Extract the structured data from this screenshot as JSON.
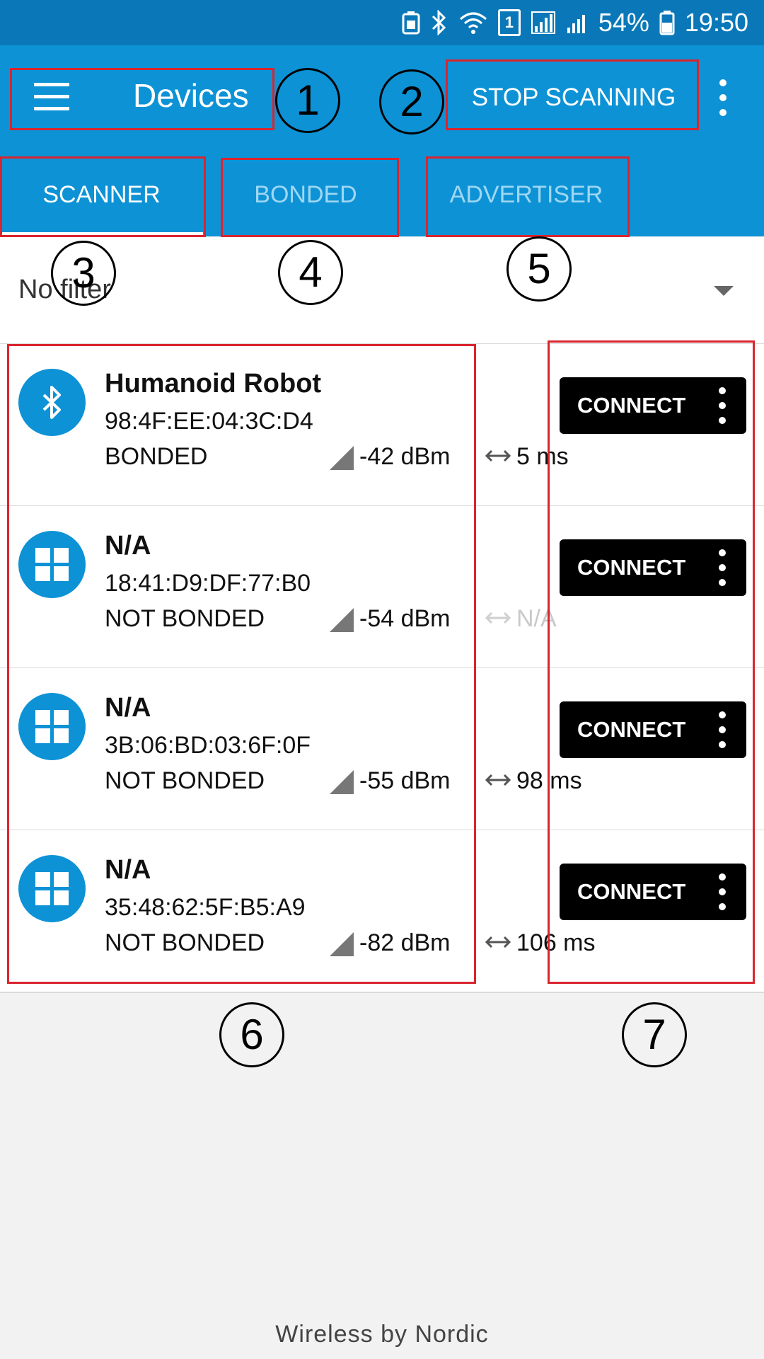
{
  "status_bar": {
    "battery_percent": "54%",
    "time": "19:50",
    "sim_slot": "1"
  },
  "app_bar": {
    "title": "Devices",
    "action_label": "STOP SCANNING"
  },
  "tabs": [
    {
      "label": "SCANNER",
      "active": true
    },
    {
      "label": "BONDED",
      "active": false
    },
    {
      "label": "ADVERTISER",
      "active": false
    }
  ],
  "filter": {
    "selected": "No filter"
  },
  "devices": [
    {
      "icon": "bluetooth-icon",
      "name": "Humanoid Robot",
      "address": "98:4F:EE:04:3C:D4",
      "bond_state": "BONDED",
      "rssi": "-42 dBm",
      "interval": "5 ms",
      "connect_label": "CONNECT"
    },
    {
      "icon": "windows-icon",
      "name": "N/A",
      "address": "18:41:D9:DF:77:B0",
      "bond_state": "NOT BONDED",
      "rssi": "-54 dBm",
      "interval": "N/A",
      "connect_label": "CONNECT"
    },
    {
      "icon": "windows-icon",
      "name": "N/A",
      "address": "3B:06:BD:03:6F:0F",
      "bond_state": "NOT BONDED",
      "rssi": "-55 dBm",
      "interval": "98 ms",
      "connect_label": "CONNECT"
    },
    {
      "icon": "windows-icon",
      "name": "N/A",
      "address": "35:48:62:5F:B5:A9",
      "bond_state": "NOT BONDED",
      "rssi": "-82 dBm",
      "interval": "106 ms",
      "connect_label": "CONNECT"
    }
  ],
  "annotations": [
    "1",
    "2",
    "3",
    "4",
    "5",
    "6",
    "7"
  ],
  "footer": "Wireless by Nordic",
  "colors": {
    "primary": "#0d92d6",
    "status_bar": "#0a78b8",
    "annotation": "#d9252e"
  }
}
